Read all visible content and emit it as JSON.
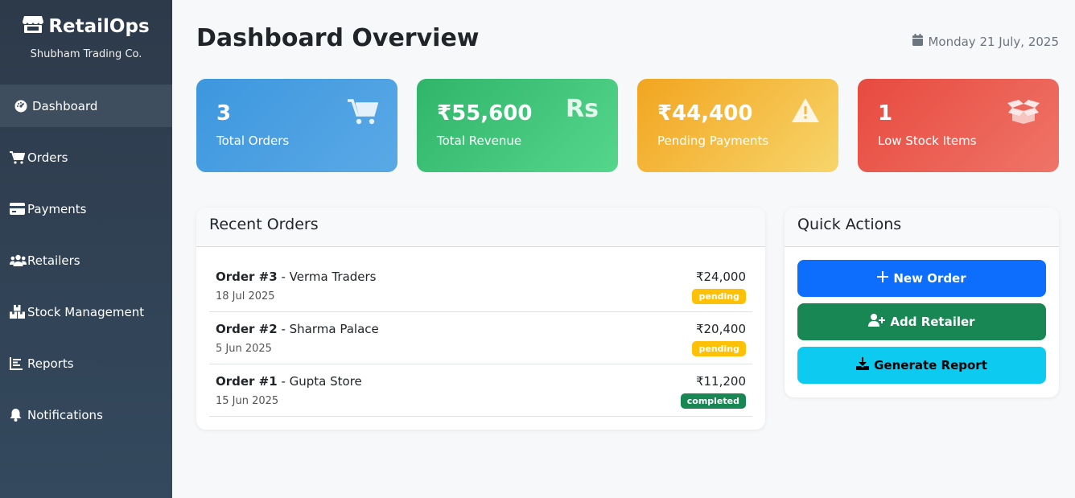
{
  "brand": {
    "name": "RetailOps",
    "company": "Shubham Trading Co.",
    "icon": "store-icon"
  },
  "sidebar": {
    "items": [
      {
        "label": "Dashboard",
        "icon": "gauge-icon",
        "active": true
      },
      {
        "label": "Orders",
        "icon": "cart-icon"
      },
      {
        "label": "Payments",
        "icon": "credit-card-icon"
      },
      {
        "label": "Retailers",
        "icon": "users-icon"
      },
      {
        "label": "Stock Management",
        "icon": "boxes-icon"
      },
      {
        "label": "Reports",
        "icon": "chart-icon"
      },
      {
        "label": "Notifications",
        "icon": "bell-icon"
      }
    ]
  },
  "header": {
    "title": "Dashboard Overview",
    "date": "Monday 21 July, 2025"
  },
  "stats": [
    {
      "value": "3",
      "label": "Total Orders",
      "icon": "cart-icon",
      "color": "#3d97de"
    },
    {
      "value": "₹55,600",
      "label": "Total Revenue",
      "icon": "rupee-icon",
      "color": "#2fb56a"
    },
    {
      "value": "₹44,400",
      "label": "Pending Payments",
      "icon": "warning-icon",
      "color": "#f2a51f"
    },
    {
      "value": "1",
      "label": "Low Stock Items",
      "icon": "open-box-icon",
      "color": "#e84a3f"
    }
  ],
  "recent_orders": {
    "title": "Recent Orders",
    "rows": [
      {
        "order": "Order #3",
        "retailer": "- Verma Traders",
        "date": "18 Jul 2025",
        "amount": "₹24,000",
        "status": "pending"
      },
      {
        "order": "Order #2",
        "retailer": "- Sharma Palace",
        "date": "5 Jun 2025",
        "amount": "₹20,400",
        "status": "pending"
      },
      {
        "order": "Order #1",
        "retailer": "- Gupta Store",
        "date": "15 Jun 2025",
        "amount": "₹11,200",
        "status": "completed"
      }
    ]
  },
  "quick_actions": {
    "title": "Quick Actions",
    "new_order": "New Order",
    "add_retailer": "Add Retailer",
    "generate_report": "Generate Report"
  }
}
